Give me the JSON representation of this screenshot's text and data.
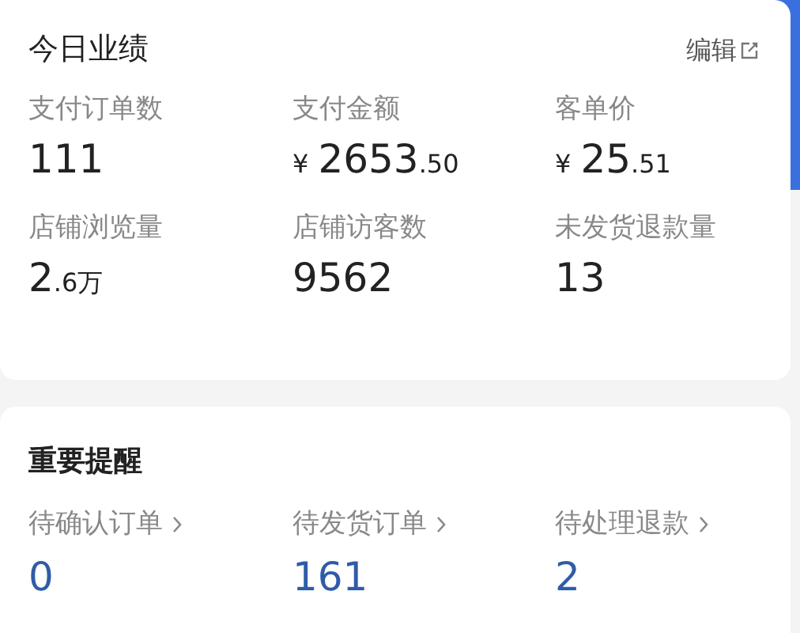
{
  "performance": {
    "title": "今日业绩",
    "edit_link": "编辑",
    "metrics": [
      {
        "label": "支付订单数",
        "value": "111"
      },
      {
        "label": "支付金额",
        "currency": "¥",
        "value": "2653",
        "fraction": ".50"
      },
      {
        "label": "客单价",
        "currency": "¥",
        "value": "25",
        "fraction": ".51"
      },
      {
        "label": "店铺浏览量",
        "value": "2",
        "fraction": ".6万"
      },
      {
        "label": "店铺访客数",
        "value": "9562"
      },
      {
        "label": "未发货退款量",
        "value": "13"
      }
    ]
  },
  "reminders": {
    "title": "重要提醒",
    "items": [
      {
        "label": "待确认订单",
        "value": "0"
      },
      {
        "label": "待发货订单",
        "value": "161"
      },
      {
        "label": "待处理退款",
        "value": "2"
      }
    ]
  }
}
